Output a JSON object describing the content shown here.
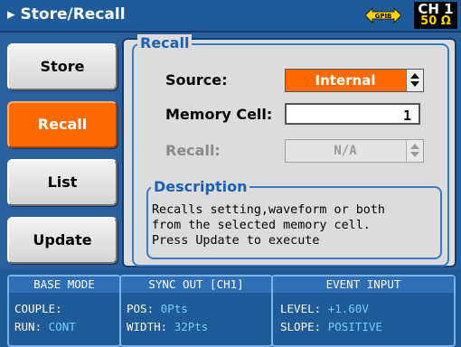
{
  "header": {
    "title": "Store/Recall",
    "gpib_label": "GPIB",
    "channel": "CH 1",
    "impedance": "50 Ω"
  },
  "softkeys": [
    {
      "label": "Store",
      "active": false
    },
    {
      "label": "Recall",
      "active": true
    },
    {
      "label": "List",
      "active": false
    },
    {
      "label": "Update",
      "active": false
    }
  ],
  "recall": {
    "legend": "Recall",
    "source_label": "Source:",
    "source_value": "Internal",
    "memory_cell_label": "Memory Cell:",
    "memory_cell_value": "1",
    "recall_label": "Recall:",
    "recall_value": "N/A"
  },
  "description": {
    "legend": "Description",
    "text": "Recalls setting,waveform or both\nfrom the selected memory cell.\nPress Update to execute"
  },
  "status": {
    "base_mode": {
      "header": "BASE MODE",
      "couple_label": "COUPLE:",
      "couple_value": "",
      "run_label": "RUN:",
      "run_value": "CONT"
    },
    "sync_out": {
      "header": "SYNC OUT [CH1]",
      "pos_label": "POS:",
      "pos_value": "0Pts",
      "width_label": "WIDTH:",
      "width_value": "32Pts"
    },
    "event_input": {
      "header": "EVENT INPUT",
      "level_label": "LEVEL:",
      "level_value": "+1.60V",
      "slope_label": "SLOPE:",
      "slope_value": "POSITIVE"
    }
  },
  "colors": {
    "accent": "#ff6a00",
    "frame": "#3d78c4",
    "background": "#2a5f9b",
    "status_value": "#6fd0ff",
    "channel_impedance": "#ffd400"
  }
}
